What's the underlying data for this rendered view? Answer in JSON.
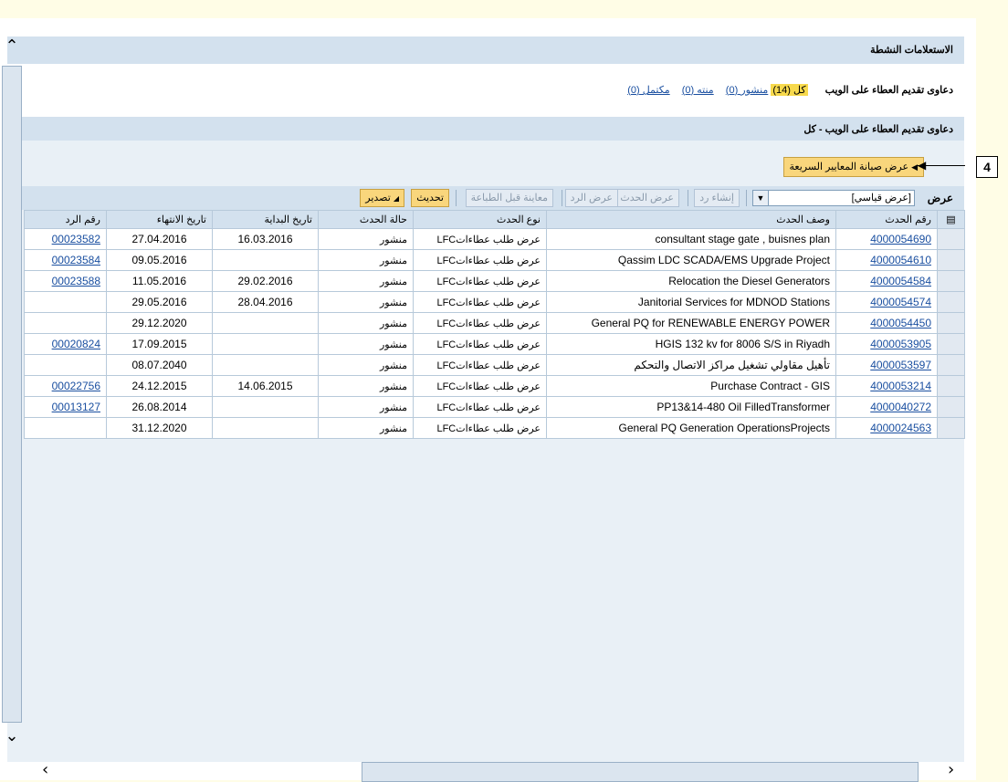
{
  "active_inquiries_title": "الاستعلامات النشطة",
  "web_bids_label": "دعاوى تقديم العطاء على الويب",
  "filters": {
    "all": "كل (14)",
    "published": "منشور (0)",
    "ended": "منته (0)",
    "completed": "مكتمل (0)"
  },
  "section_title": "دعاوى تقديم العطاء على الويب - كل",
  "quick_criteria_button": "عرض صيانة المعايير السريعة",
  "callout_number": "4",
  "toolbar": {
    "view_label": "عرض",
    "view_value": "[عرض قياسي]",
    "create_response": "إنشاء رد",
    "show_event": "عرض الحدث",
    "show_response": "عرض الرد",
    "print_preview": "معاينة قبل الطباعة",
    "refresh": "تحديث",
    "export": "تصدير"
  },
  "table": {
    "headers": {
      "event_no": "رقم الحدث",
      "event_desc": "وصف الحدث",
      "event_type": "نوع الحدث",
      "event_status": "حالة الحدث",
      "start_date": "تاريخ البداية",
      "end_date": "تاريخ الانتهاء",
      "response_no": "رقم الرد"
    },
    "rows": [
      {
        "event_no": "4000054690",
        "desc": "consultant stage gate , buisnes plan",
        "type": "عرض طلب عطاءاتLFC",
        "status": "منشور",
        "start": "16.03.2016",
        "end": "27.04.2016",
        "response": "00023582"
      },
      {
        "event_no": "4000054610",
        "desc": "Qassim LDC SCADA/EMS Upgrade Project",
        "type": "عرض طلب عطاءاتLFC",
        "status": "منشور",
        "start": "",
        "end": "09.05.2016",
        "response": "00023584"
      },
      {
        "event_no": "4000054584",
        "desc": "Relocation the Diesel Generators",
        "type": "عرض طلب عطاءاتLFC",
        "status": "منشور",
        "start": "29.02.2016",
        "end": "11.05.2016",
        "response": "00023588"
      },
      {
        "event_no": "4000054574",
        "desc": "Janitorial Services for MDNOD Stations",
        "type": "عرض طلب عطاءاتLFC",
        "status": "منشور",
        "start": "28.04.2016",
        "end": "29.05.2016",
        "response": ""
      },
      {
        "event_no": "4000054450",
        "desc": "General PQ for RENEWABLE ENERGY POWER",
        "type": "عرض طلب عطاءاتLFC",
        "status": "منشور",
        "start": "",
        "end": "29.12.2020",
        "response": ""
      },
      {
        "event_no": "4000053905",
        "desc": "HGIS 132 kv for 8006 S/S in Riyadh",
        "type": "عرض طلب عطاءاتLFC",
        "status": "منشور",
        "start": "",
        "end": "17.09.2015",
        "response": "00020824"
      },
      {
        "event_no": "4000053597",
        "desc": "تأهيل مقاولي تشغيل مراكز الاتصال والتحكم",
        "type": "عرض طلب عطاءاتLFC",
        "status": "منشور",
        "start": "",
        "end": "08.07.2040",
        "response": ""
      },
      {
        "event_no": "4000053214",
        "desc": "Purchase Contract - GIS",
        "type": "عرض طلب عطاءاتLFC",
        "status": "منشور",
        "start": "14.06.2015",
        "end": "24.12.2015",
        "response": "00022756"
      },
      {
        "event_no": "4000040272",
        "desc": "PP13&14-480 Oil FilledTransformer",
        "type": "عرض طلب عطاءاتLFC",
        "status": "منشور",
        "start": "",
        "end": "26.08.2014",
        "response": "00013127"
      },
      {
        "event_no": "4000024563",
        "desc": "General PQ Generation OperationsProjects",
        "type": "عرض طلب عطاءاتLFC",
        "status": "منشور",
        "start": "",
        "end": "31.12.2020",
        "response": ""
      }
    ]
  }
}
